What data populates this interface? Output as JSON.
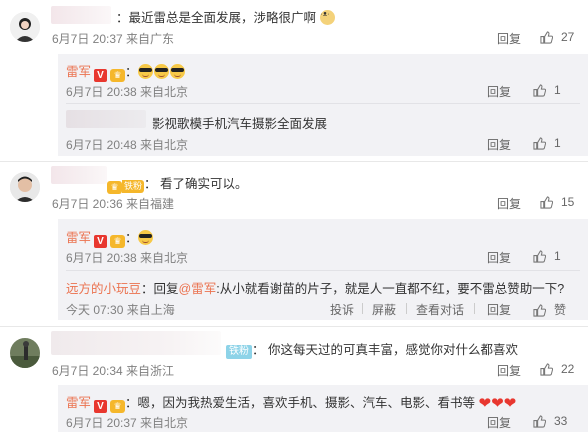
{
  "c1": {
    "text": "最近雷总是全面发展，涉略很广啊",
    "meta": "6月7日 20:37 来自广东",
    "reply": "回复",
    "likes": "27"
  },
  "c1r1": {
    "name": "雷军",
    "meta": "6月7日 20:38 来自北京",
    "reply": "回复",
    "likes": "1"
  },
  "c1r2": {
    "text": "影视歌模手机汽车摄影全面发展",
    "meta": "6月7日 20:48 来自北京",
    "reply": "回复",
    "likes": "1"
  },
  "c2": {
    "fan_label": "铁粉",
    "text": "看了确实可以。",
    "meta": "6月7日 20:36 来自福建",
    "reply": "回复",
    "likes": "15"
  },
  "c2r1": {
    "name": "雷军",
    "meta": "6月7日 20:38 来自北京",
    "reply": "回复",
    "likes": "1"
  },
  "c2r2": {
    "name": "远方的小玩豆",
    "reply_prefix": "：回复",
    "mention": "@雷军",
    "text": ":从小就看谢苗的片子，就是人一直都不红，要不雷总赞助一下?",
    "meta": "今天 07:30 来自上海",
    "actions": [
      "投诉",
      "屏蔽",
      "查看对话",
      "回复"
    ],
    "like_label": "赞"
  },
  "c3": {
    "fan_label": "铁粉",
    "text": "你这每天过的可真丰富，感觉你对什么都喜欢",
    "meta": "6月7日 20:34 来自浙江",
    "reply": "回复",
    "likes": "22"
  },
  "c3r1": {
    "name": "雷军",
    "text": "：嗯，因为我热爱生活，喜欢手机、摄影、汽车、电影、看书等",
    "meta": "6月7日 20:37 来自北京",
    "reply": "回复",
    "likes": "33"
  },
  "icons": {
    "like": "thumb-up-icon",
    "verified": "verified-v-icon",
    "fan": "fan-badge-icon"
  },
  "colors": {
    "name": "#eb7350",
    "verified": "#e8372f",
    "panel": "#f2f2f5"
  }
}
